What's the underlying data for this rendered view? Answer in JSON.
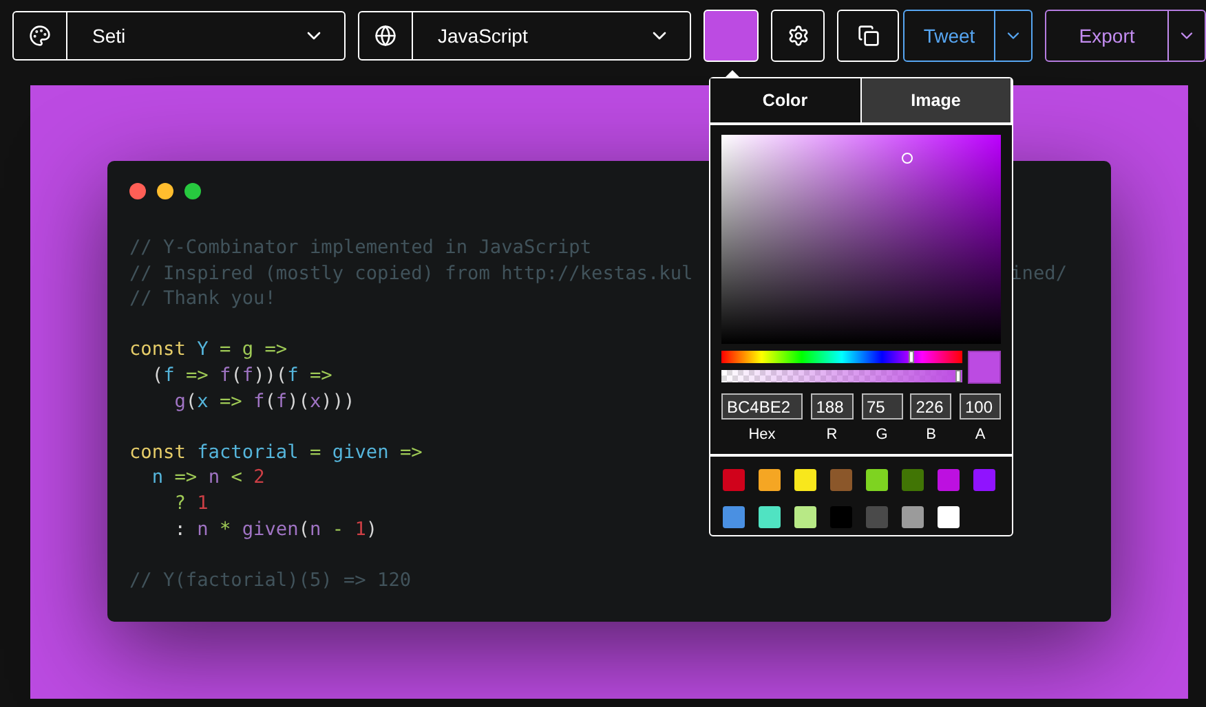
{
  "toolbar": {
    "theme": {
      "value": "Seti"
    },
    "language": {
      "value": "JavaScript"
    },
    "tweet": {
      "label": "Tweet"
    },
    "export": {
      "label": "Export"
    }
  },
  "code_window": {
    "lines": [
      {
        "kind": "code",
        "tokens": [
          {
            "kind": "comment",
            "text": "// Y-Combinator implemented in JavaScript"
          }
        ]
      },
      {
        "kind": "code",
        "tokens": [
          {
            "kind": "comment",
            "text": "// Inspired (mostly copied) from http://kestas.kul"
          }
        ],
        "tail": "ined/"
      },
      {
        "kind": "code",
        "tokens": [
          {
            "kind": "comment",
            "text": "// Thank you!"
          }
        ]
      },
      {
        "kind": "blank"
      },
      {
        "kind": "code",
        "tokens": [
          {
            "kind": "keyword",
            "text": "const "
          },
          {
            "kind": "var",
            "text": "Y "
          },
          {
            "kind": "op",
            "text": "= "
          },
          {
            "kind": "op",
            "text": "g "
          },
          {
            "kind": "op",
            "text": "=>"
          }
        ]
      },
      {
        "kind": "code",
        "tokens": [
          {
            "kind": "plain",
            "text": "  ("
          },
          {
            "kind": "var",
            "text": "f "
          },
          {
            "kind": "op",
            "text": "=> "
          },
          {
            "kind": "fn",
            "text": "f"
          },
          {
            "kind": "plain",
            "text": "("
          },
          {
            "kind": "fn",
            "text": "f"
          },
          {
            "kind": "plain",
            "text": "))("
          },
          {
            "kind": "var",
            "text": "f "
          },
          {
            "kind": "op",
            "text": "=>"
          }
        ]
      },
      {
        "kind": "code",
        "tokens": [
          {
            "kind": "fn",
            "text": "    g"
          },
          {
            "kind": "plain",
            "text": "("
          },
          {
            "kind": "var",
            "text": "x "
          },
          {
            "kind": "op",
            "text": "=> "
          },
          {
            "kind": "fn",
            "text": "f"
          },
          {
            "kind": "plain",
            "text": "("
          },
          {
            "kind": "fn",
            "text": "f"
          },
          {
            "kind": "plain",
            "text": ")("
          },
          {
            "kind": "fn",
            "text": "x"
          },
          {
            "kind": "plain",
            "text": ")))"
          }
        ]
      },
      {
        "kind": "blank"
      },
      {
        "kind": "code",
        "tokens": [
          {
            "kind": "keyword",
            "text": "const "
          },
          {
            "kind": "var",
            "text": "factorial "
          },
          {
            "kind": "op",
            "text": "= "
          },
          {
            "kind": "var",
            "text": "given "
          },
          {
            "kind": "op",
            "text": "=>"
          }
        ]
      },
      {
        "kind": "code",
        "tokens": [
          {
            "kind": "var",
            "text": "  n "
          },
          {
            "kind": "op",
            "text": "=> "
          },
          {
            "kind": "fn",
            "text": "n "
          },
          {
            "kind": "op",
            "text": "< "
          },
          {
            "kind": "num",
            "text": "2"
          }
        ]
      },
      {
        "kind": "code",
        "tokens": [
          {
            "kind": "op",
            "text": "    ? "
          },
          {
            "kind": "num",
            "text": "1"
          }
        ]
      },
      {
        "kind": "code",
        "tokens": [
          {
            "kind": "plain",
            "text": "    : "
          },
          {
            "kind": "fn",
            "text": "n "
          },
          {
            "kind": "op",
            "text": "* "
          },
          {
            "kind": "fn",
            "text": "given"
          },
          {
            "kind": "plain",
            "text": "("
          },
          {
            "kind": "fn",
            "text": "n "
          },
          {
            "kind": "op",
            "text": "- "
          },
          {
            "kind": "num",
            "text": "1"
          },
          {
            "kind": "plain",
            "text": ")"
          }
        ]
      },
      {
        "kind": "blank"
      },
      {
        "kind": "code",
        "tokens": [
          {
            "kind": "comment",
            "text": "// Y(factorial)(5) => 120"
          }
        ]
      }
    ]
  },
  "color_picker": {
    "tabs": [
      {
        "label": "Color",
        "selected": true
      },
      {
        "label": "Image",
        "selected": false
      }
    ],
    "hue": {
      "level": 0.79
    },
    "alpha": {
      "level": 0.98
    },
    "fields": [
      {
        "label": "Hex",
        "value": "BC4BE2"
      },
      {
        "label": "R",
        "value": "188"
      },
      {
        "label": "G",
        "value": "75"
      },
      {
        "label": "B",
        "value": "226"
      },
      {
        "label": "A",
        "value": "100"
      }
    ],
    "swatches": [
      {
        "color": "#d0021b"
      },
      {
        "color": "#f5a623"
      },
      {
        "color": "#f8e71c"
      },
      {
        "color": "#8b572a"
      },
      {
        "color": "#7ed321"
      },
      {
        "color": "#417505"
      },
      {
        "color": "#bd10e0"
      },
      {
        "color": "#9013fe"
      },
      {
        "color": "#4a90e2"
      },
      {
        "color": "#50e3c2"
      },
      {
        "color": "#b8e986"
      },
      {
        "color": "#000000"
      },
      {
        "color": "#4a4a4a"
      },
      {
        "color": "#9b9b9b"
      },
      {
        "color": "#ffffff"
      }
    ]
  }
}
